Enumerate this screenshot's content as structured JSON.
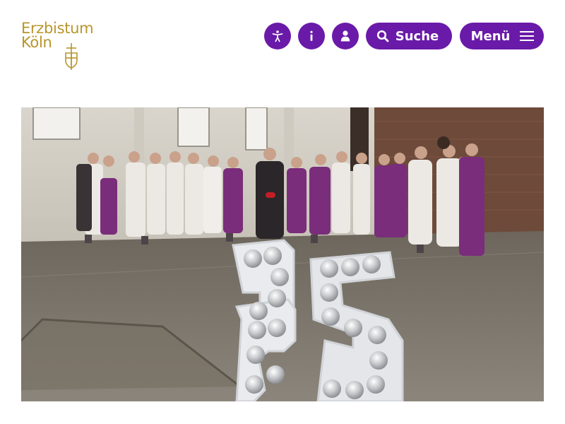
{
  "header": {
    "logo": {
      "line1": "Erzbistum",
      "line2": "Köln"
    },
    "icons": [
      {
        "name": "accessibility-icon",
        "label": "Barrierefreiheit"
      },
      {
        "name": "info-icon",
        "label": "Info"
      },
      {
        "name": "user-icon",
        "label": "Login"
      }
    ],
    "search_label": "Suche",
    "menu_label": "Menü"
  },
  "hero": {
    "alt": "Gruppenfoto mit Geistlichen in violetten Gewändern vor einem Gebäude, davor eine große Leuchtziffer 25"
  },
  "colors": {
    "brand_gold": "#b8952a",
    "accent_purple": "#6a1aa8"
  }
}
